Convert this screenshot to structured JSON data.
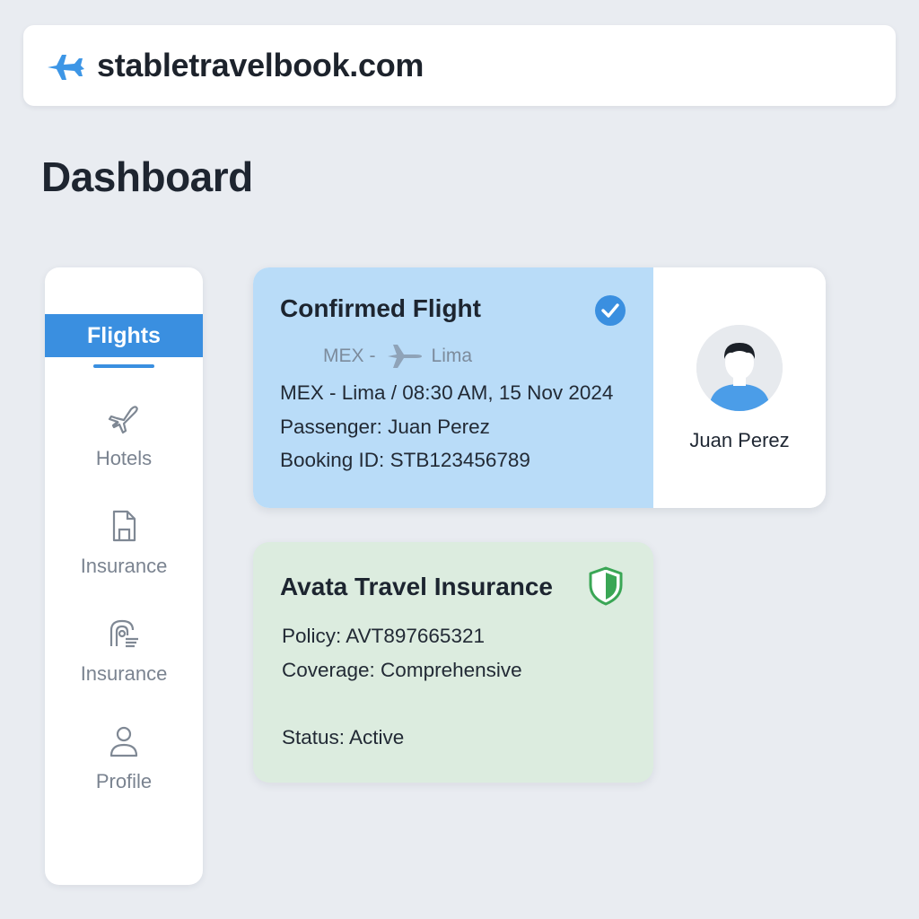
{
  "browser": {
    "url": "stabletravelbook.com",
    "icon": "plane-icon"
  },
  "page": {
    "title": "Dashboard"
  },
  "sidebar": {
    "active": {
      "label": "Flights"
    },
    "items": [
      {
        "label": "Hotels",
        "icon": "plane-icon"
      },
      {
        "label": "Insurance",
        "icon": "document-icon"
      },
      {
        "label": "Insurance",
        "icon": "insurance-icon"
      },
      {
        "label": "Profile",
        "icon": "user-icon"
      }
    ]
  },
  "flight_card": {
    "title": "Confirmed Flight",
    "status_icon": "check-circle-icon",
    "route_from": "MEX",
    "route_sep": "-",
    "route_to": "Lima",
    "line1": "MEX - Lima / 08:30 AM, 15 Nov 2024",
    "line2": "Passenger: Juan Perez",
    "line3": "Booking ID: STB123456789",
    "passenger_name": "Juan Perez"
  },
  "insurance_card": {
    "title": "Avata Travel Insurance",
    "status_icon": "shield-icon",
    "policy": "Policy: AVT897665321",
    "coverage": "Coverage: Comprehensive",
    "status": "Status: Active"
  },
  "colors": {
    "accent": "#3a8fe0",
    "flight_card_bg": "#b9dcf8",
    "insurance_card_bg": "#dcecdf",
    "shield_green": "#3aa655",
    "page_bg": "#e9ecf1"
  }
}
